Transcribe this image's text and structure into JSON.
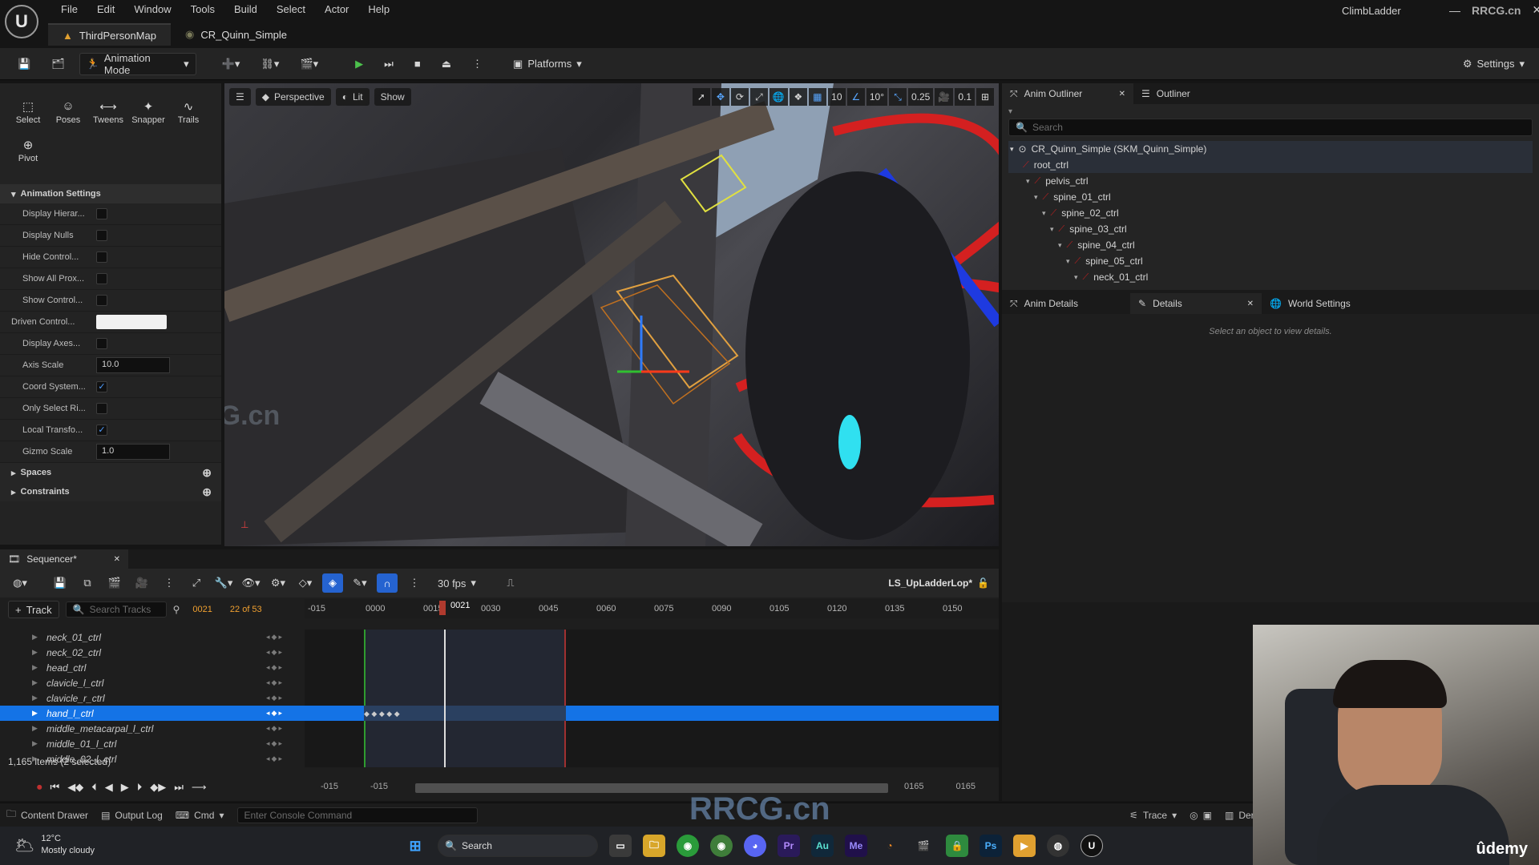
{
  "menu": [
    "File",
    "Edit",
    "Window",
    "Tools",
    "Build",
    "Select",
    "Actor",
    "Help"
  ],
  "window": {
    "project": "ClimbLadder",
    "brand": "RRCG.cn"
  },
  "doc_tabs": [
    {
      "label": "ThirdPersonMap"
    },
    {
      "label": "CR_Quinn_Simple"
    }
  ],
  "toolbar": {
    "mode": "Animation Mode",
    "platforms": "Platforms",
    "settings": "Settings"
  },
  "tools": [
    {
      "label": "Select",
      "icon": "⬚"
    },
    {
      "label": "Poses",
      "icon": "☺"
    },
    {
      "label": "Tweens",
      "icon": "⟷"
    },
    {
      "label": "Snapper",
      "icon": "✦"
    },
    {
      "label": "Trails",
      "icon": "∿"
    },
    {
      "label": "Pivot",
      "icon": "⊕"
    }
  ],
  "anim_settings": {
    "title": "Animation Settings",
    "rows": [
      {
        "label": "Display Hierar...",
        "type": "check",
        "checked": false
      },
      {
        "label": "Display Nulls",
        "type": "check",
        "checked": false
      },
      {
        "label": "Hide Control...",
        "type": "check",
        "checked": false
      },
      {
        "label": "Show All Prox...",
        "type": "check",
        "checked": false
      },
      {
        "label": "Show Control...",
        "type": "check",
        "checked": false
      },
      {
        "label": "Driven Control...",
        "type": "color",
        "value": "#f0f0f0"
      },
      {
        "label": "Display Axes...",
        "type": "check",
        "checked": false
      },
      {
        "label": "Axis Scale",
        "type": "num",
        "value": "10.0"
      },
      {
        "label": "Coord System...",
        "type": "check",
        "checked": true
      },
      {
        "label": "Only Select Ri...",
        "type": "check",
        "checked": false
      },
      {
        "label": "Local Transfo...",
        "type": "check",
        "checked": true
      },
      {
        "label": "Gizmo Scale",
        "type": "num",
        "value": "1.0"
      }
    ],
    "spaces": "Spaces",
    "constraints": "Constraints"
  },
  "viewport": {
    "perspective": "Perspective",
    "lit": "Lit",
    "show": "Show",
    "grid": "10",
    "angle": "10°",
    "scale": "0.25",
    "camera": "0.1"
  },
  "anim_outliner": {
    "tab": "Anim Outliner",
    "tab2": "Outliner",
    "search_placeholder": "Search",
    "root": "CR_Quinn_Simple  (SKM_Quinn_Simple)",
    "items": [
      "root_ctrl",
      "pelvis_ctrl",
      "spine_01_ctrl",
      "spine_02_ctrl",
      "spine_03_ctrl",
      "spine_04_ctrl",
      "spine_05_ctrl",
      "neck_01_ctrl"
    ]
  },
  "details": {
    "tab1": "Anim Details",
    "tab2": "Details",
    "tab3": "World Settings",
    "empty": "Select an object to view details."
  },
  "sequencer": {
    "tab": "Sequencer*",
    "fps": "30 fps",
    "sequence": "LS_UpLadderLop*",
    "add_track": "Track",
    "search_placeholder": "Search Tracks",
    "frame": "0021",
    "frame_count": "22 of 53",
    "playhead_label": "0021",
    "ruler": [
      "-015",
      "0000",
      "0015",
      "0030",
      "0045",
      "0060",
      "0075",
      "0090",
      "0105",
      "0120",
      "0135",
      "0150"
    ],
    "tracks": [
      "neck_01_ctrl",
      "neck_02_ctrl",
      "head_ctrl",
      "clavicle_l_ctrl",
      "clavicle_r_ctrl",
      "hand_l_ctrl",
      "middle_metacarpal_l_ctrl",
      "middle_01_l_ctrl",
      "middle_02_l_ctrl"
    ],
    "selected_track": 5,
    "items_status": "1,165 items (2 selected)",
    "range": {
      "start_a": "-015",
      "start_b": "-015",
      "end_a": "0165",
      "end_b": "0165"
    }
  },
  "statusbar": {
    "content_drawer": "Content Drawer",
    "output_log": "Output Log",
    "cmd": "Cmd",
    "console_placeholder": "Enter Console Command",
    "trace": "Trace",
    "derive": "Derive"
  },
  "taskbar": {
    "temp": "12°C",
    "weather": "Mostly cloudy",
    "search": "Search",
    "udemy": "ûdemy"
  }
}
